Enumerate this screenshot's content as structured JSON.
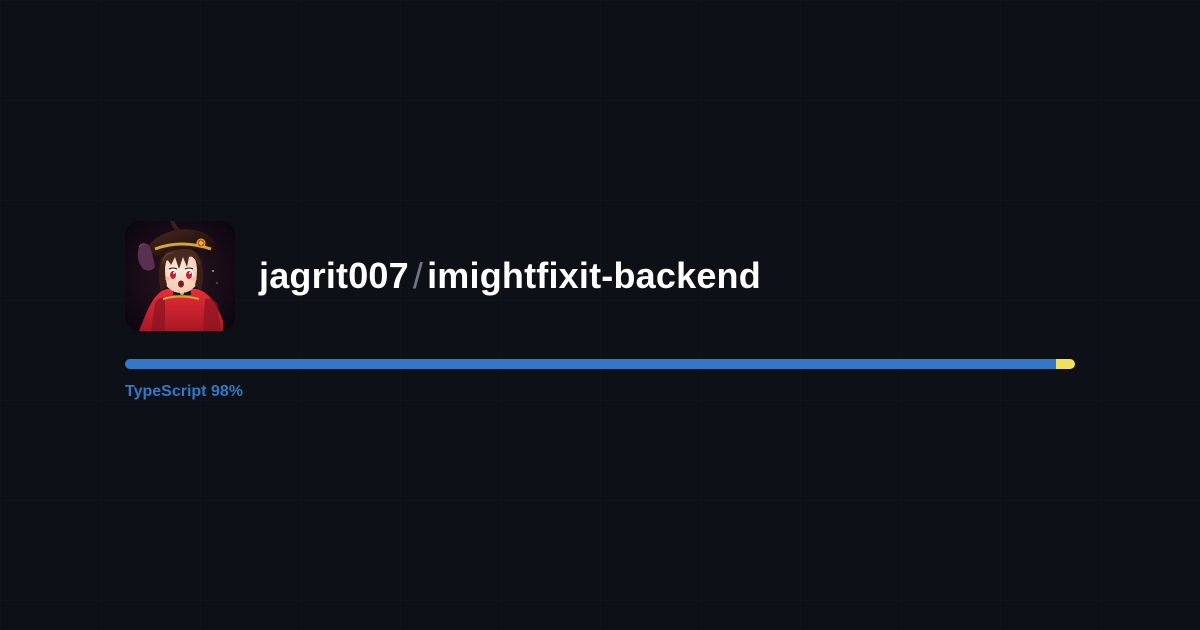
{
  "repo": {
    "owner": "jagrit007",
    "name": "imightfixit-backend"
  },
  "avatar": {
    "semantic": "user-avatar-anime-character"
  },
  "language_bar": {
    "primary": {
      "name": "TypeScript",
      "percent": 98,
      "color": "#3178c6"
    },
    "remainder": {
      "percent": 2,
      "color": "#f1e05a"
    },
    "label": "TypeScript 98%",
    "label_color": "#3178c6"
  }
}
